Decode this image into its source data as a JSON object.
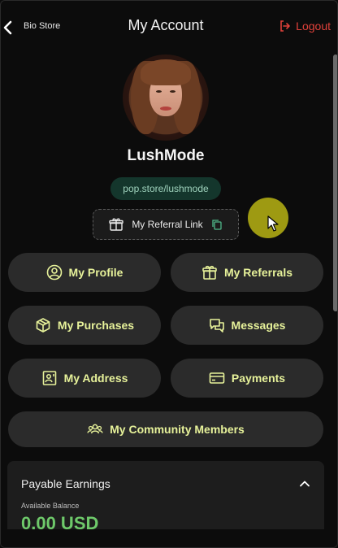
{
  "header": {
    "store_name": "Bio Store",
    "title": "My Account",
    "logout_label": "Logout"
  },
  "profile": {
    "username": "LushMode",
    "store_link": "pop.store/lushmode",
    "referral_label": "My Referral Link"
  },
  "menu": {
    "my_profile": "My Profile",
    "my_referrals": "My Referrals",
    "my_purchases": "My Purchases",
    "messages": "Messages",
    "my_address": "My Address",
    "payments": "Payments",
    "community": "My Community Members"
  },
  "earnings": {
    "title": "Payable Earnings",
    "balance_label": "Available Balance",
    "balance_value": "0.00 USD"
  },
  "colors": {
    "accent": "#e7f29a",
    "logout": "#e0413a",
    "link_bg": "#14362c",
    "button_bg": "#2b2b2b",
    "amount": "#6ec96a"
  },
  "icons": [
    "back-arrow-icon",
    "logout-icon",
    "gift-icon",
    "copy-icon",
    "user-circle-icon",
    "box-icon",
    "chat-icon",
    "address-book-icon",
    "credit-card-icon",
    "users-icon",
    "chevron-up-icon"
  ]
}
